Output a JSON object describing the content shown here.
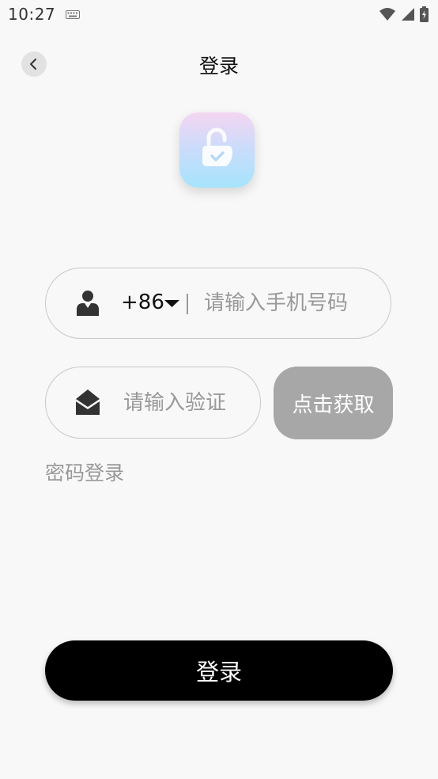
{
  "status_bar": {
    "time": "10:27",
    "icons": [
      "keyboard-icon",
      "wifi-icon",
      "signal-icon",
      "battery-charging-icon"
    ]
  },
  "header": {
    "title": "登录",
    "back_icon": "chevron-left-icon"
  },
  "logo": {
    "icon": "unlock-check-icon",
    "gradient": [
      "#f4d6f2",
      "#a5e4fc"
    ]
  },
  "phone_field": {
    "icon": "user-icon",
    "country_code": "+86",
    "dropdown_icon": "caret-down-icon",
    "placeholder": "请输入手机号码",
    "value": ""
  },
  "code_field": {
    "icon": "envelope-open-icon",
    "placeholder": "请输入验证",
    "value": ""
  },
  "get_code_button": {
    "label": "点击获取",
    "color": "#a7a7a7"
  },
  "password_login_link": "密码登录",
  "login_button": {
    "label": "登录",
    "color": "#000000"
  }
}
